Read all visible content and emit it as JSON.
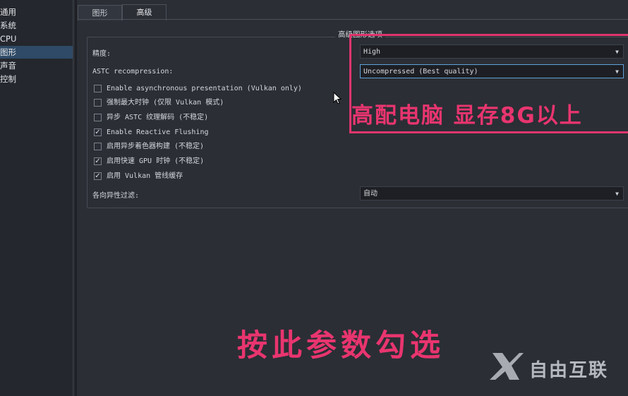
{
  "sidebar": {
    "items": [
      {
        "label": "通用"
      },
      {
        "label": "系统"
      },
      {
        "label": "CPU"
      },
      {
        "label": "图形"
      },
      {
        "label": "声音"
      },
      {
        "label": "控制"
      }
    ],
    "active_index": 3
  },
  "tabs": [
    {
      "label": "图形"
    },
    {
      "label": "高级"
    }
  ],
  "active_tab": "高级",
  "group": {
    "title": "高级图形选项",
    "accuracy_label": "精度:",
    "accuracy_value": "High",
    "astc_label": "ASTC recompression:",
    "astc_value": "Uncompressed (Best quality)",
    "anisotropic_label": "各向异性过滤:",
    "anisotropic_value": "自动",
    "checkboxes": [
      {
        "label": "Enable asynchronous presentation (Vulkan only)",
        "checked": false
      },
      {
        "label": "强制最大时钟 (仅限 Vulkan 模式)",
        "checked": false
      },
      {
        "label": "异步 ASTC 纹理解码 (不稳定)",
        "checked": false
      },
      {
        "label": "Enable Reactive Flushing",
        "checked": true
      },
      {
        "label": "启用异步着色器构建 (不稳定)",
        "checked": false
      },
      {
        "label": "启用快速 GPU 时钟 (不稳定)",
        "checked": true
      },
      {
        "label": "启用 Vulkan 管线缓存",
        "checked": true
      }
    ]
  },
  "overlay": {
    "top_text": "高配电脑 显存8G以上",
    "bottom_text": "按此参数勾选",
    "accent_color": "#e9356f"
  },
  "watermark": {
    "text": "自由互联"
  },
  "icons": {
    "check": "✓",
    "dropdown": "▼"
  }
}
